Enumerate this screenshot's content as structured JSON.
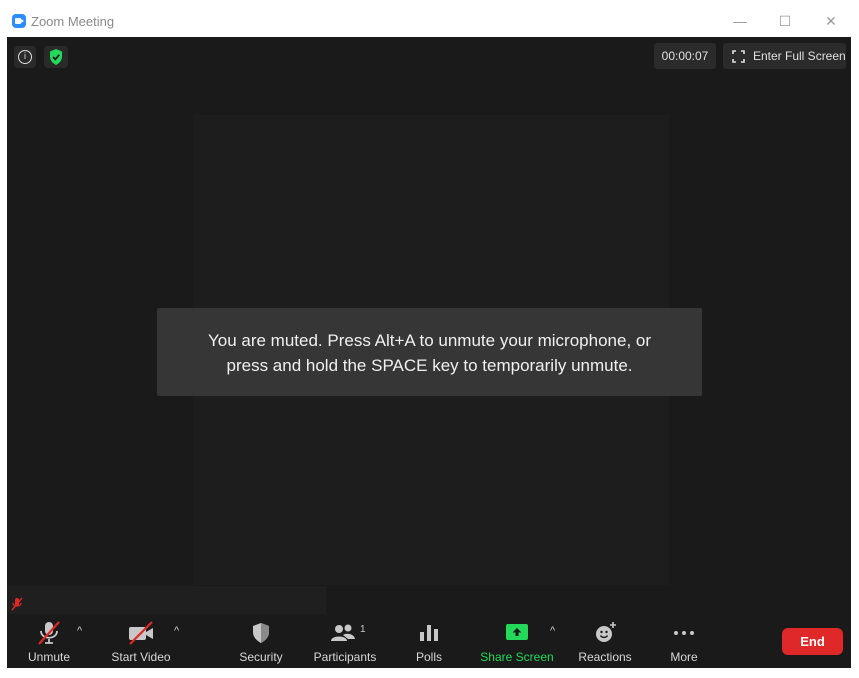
{
  "window": {
    "title": "Zoom Meeting",
    "controls": {
      "minimize": "—",
      "maximize": "☐",
      "close": "✕"
    }
  },
  "top_bar": {
    "timer": "00:00:07",
    "fullscreen_label": "Enter Full Screen",
    "info_glyph": "i"
  },
  "notification": {
    "line1": "You are muted. Press Alt+A to unmute your microphone, or",
    "line2": "press and hold the SPACE key to temporarily unmute."
  },
  "toolbar": {
    "unmute": "Unmute",
    "start_video": "Start Video",
    "security": "Security",
    "participants": "Participants",
    "participants_count": "1",
    "polls": "Polls",
    "share_screen": "Share Screen",
    "reactions": "Reactions",
    "more": "More",
    "end": "End",
    "caret": "^"
  },
  "colors": {
    "share_green": "#23d959",
    "end_red": "#e02828",
    "muted_red": "#e02828",
    "security_green": "#23d959",
    "zoom_blue": "#2D8CFF"
  },
  "icons": [
    "zoom-logo-icon",
    "info-icon",
    "shield-check-icon",
    "fullscreen-icon",
    "mic-muted-icon",
    "video-off-icon",
    "security-shield-icon",
    "participants-icon",
    "polls-icon",
    "share-screen-icon",
    "reactions-icon",
    "more-dots-icon"
  ]
}
